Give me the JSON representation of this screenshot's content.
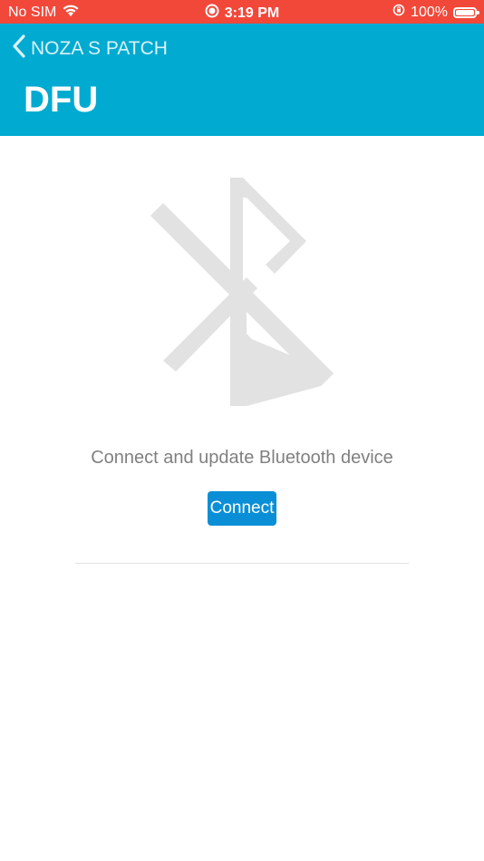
{
  "status_bar": {
    "carrier": "No SIM",
    "time": "3:19 PM",
    "battery_percent": "100%",
    "battery_level": 1.0
  },
  "nav": {
    "back_label": "NOZA S PATCH",
    "title": "DFU"
  },
  "main": {
    "icon": "bluetooth-icon",
    "message": "Connect and update Bluetooth device",
    "connect_label": "Connect"
  },
  "colors": {
    "status_bar": "#f2483a",
    "nav_bar": "#00aad0",
    "button": "#0a8fd6",
    "icon": "#e2e2e2",
    "text_muted": "#808080"
  }
}
